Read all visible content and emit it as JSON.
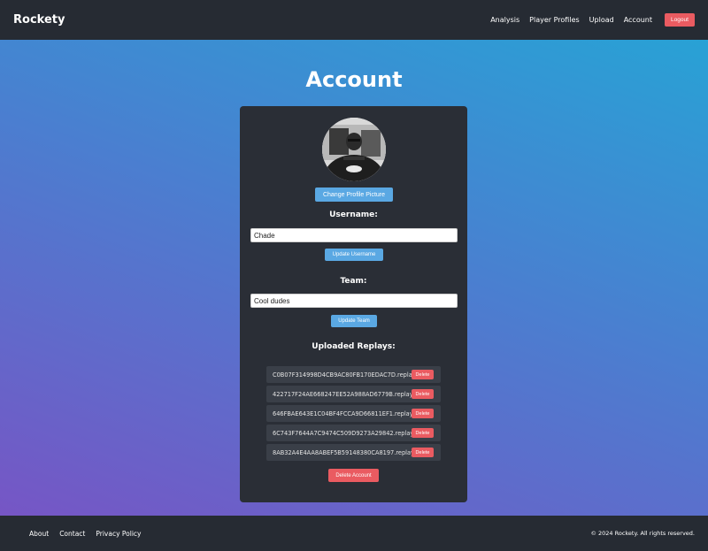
{
  "header": {
    "brand": "Rockety",
    "nav": [
      "Analysis",
      "Player Profiles",
      "Upload",
      "Account"
    ],
    "logout_label": "Logout"
  },
  "page": {
    "title": "Account"
  },
  "profile": {
    "change_picture_label": "Change Profile Picture",
    "username_label": "Username:",
    "username_value": "Chade",
    "update_username_label": "Update Username",
    "team_label": "Team:",
    "team_value": "Cool dudes",
    "update_team_label": "Update Team"
  },
  "replays": {
    "heading": "Uploaded Replays:",
    "delete_label": "Delete",
    "items": [
      "C0B07F314998D4CB9AC80FB170EDAC7D.replay",
      "422717F24AE668247EE52A988AD6779B.replay",
      "646FBAE643E1C04BF4FCCA9D66811EF1.replay",
      "6C743F7644A7C9474C509D9273A29842.replay",
      "8AB32A4E4AA8ABEF5B59148380CA8197.replay"
    ]
  },
  "delete_account_label": "Delete Account",
  "footer": {
    "links": [
      "About",
      "Contact",
      "Privacy Policy"
    ],
    "copyright": "© 2024 Rockety. All rights reserved."
  },
  "colors": {
    "accent_blue": "#5aa8e3",
    "danger_red": "#ea5b61",
    "bar_dark": "#262b33",
    "card_dark": "#2a2e36"
  }
}
